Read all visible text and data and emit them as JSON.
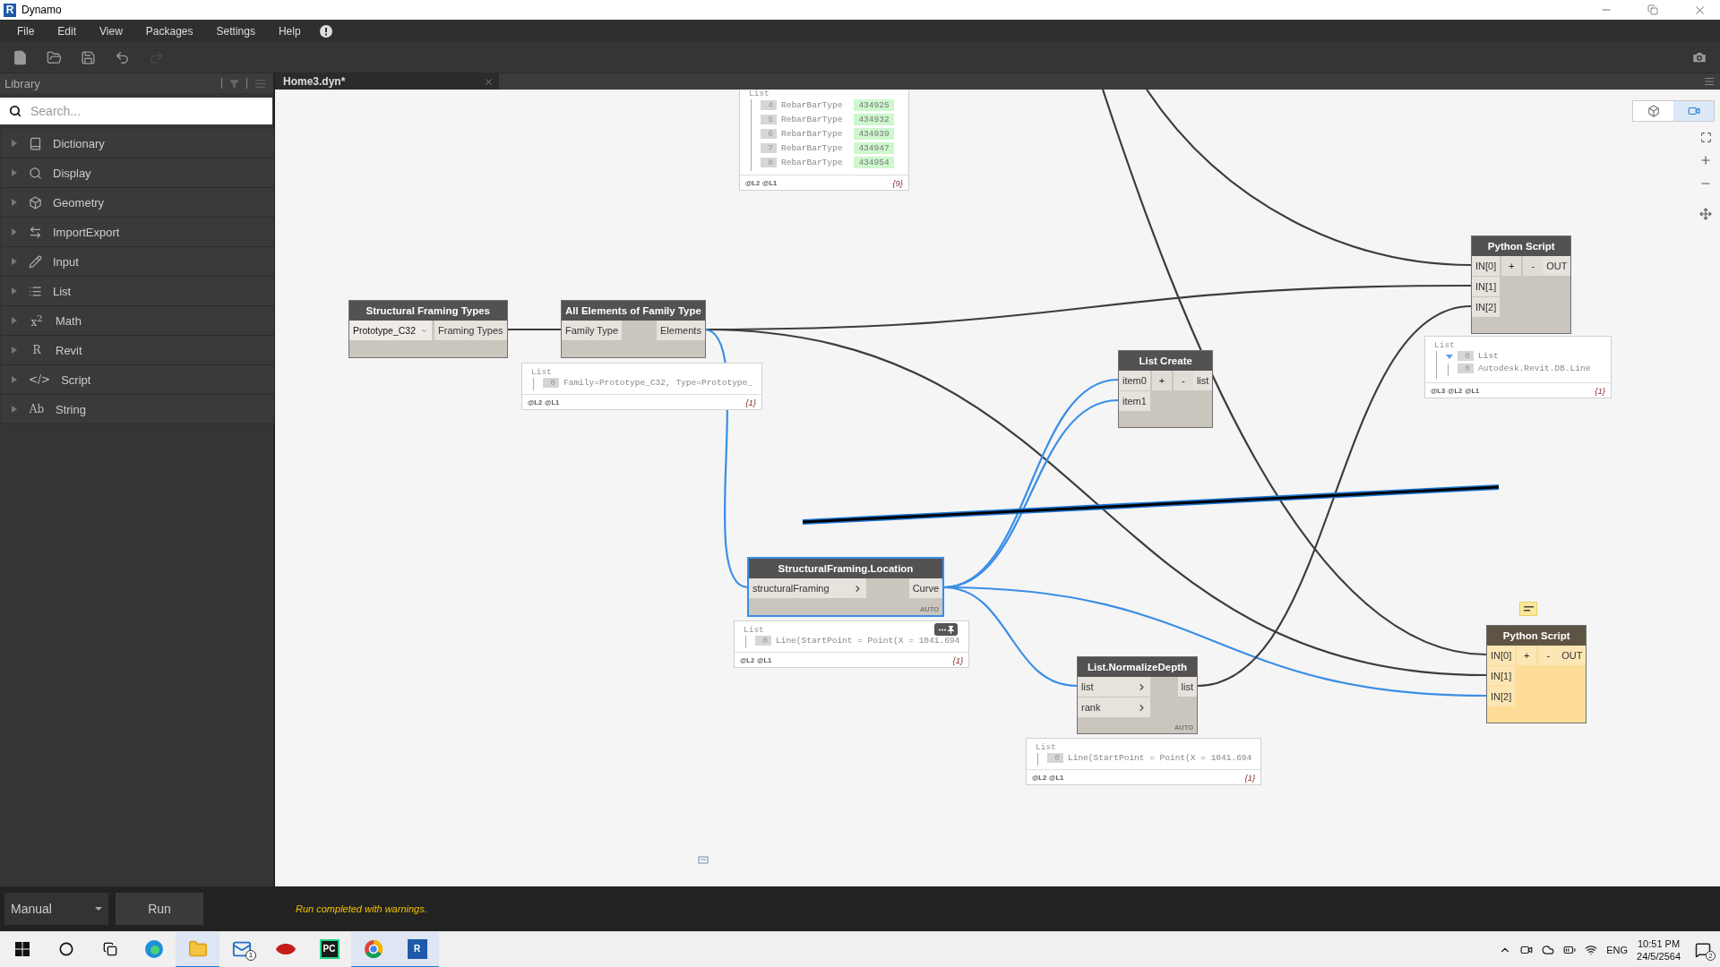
{
  "window": {
    "title": "Dynamo",
    "logo": "R"
  },
  "menu": [
    {
      "label": "File"
    },
    {
      "label": "Edit"
    },
    {
      "label": "View"
    },
    {
      "label": "Packages"
    },
    {
      "label": "Settings"
    },
    {
      "label": "Help"
    }
  ],
  "library": {
    "title": "Library",
    "search": {
      "placeholder": "Search..."
    },
    "items": [
      {
        "label": "Dictionary",
        "expanded": false
      },
      {
        "label": "Display",
        "expanded": false
      },
      {
        "label": "Geometry",
        "expanded": false
      },
      {
        "label": "ImportExport",
        "expanded": false
      },
      {
        "label": "Input",
        "expanded": false
      },
      {
        "label": "List",
        "expanded": false
      },
      {
        "label": "Math",
        "glyph": "x$^{2}$",
        "expanded": false
      },
      {
        "label": "Revit",
        "glyph": "R",
        "expanded": false
      },
      {
        "label": "Script",
        "glyph": "</>",
        "expanded": false
      },
      {
        "label": "String",
        "glyph": "Ab",
        "expanded": false
      }
    ]
  },
  "tab": {
    "title": "Home3.dyn*"
  },
  "nodes": [
    {
      "title": "Structural Framing Types",
      "kind": "dropdown",
      "selected": false,
      "warning": false,
      "dropdown": "Prototype_C32",
      "outputs": [
        "Framing Types"
      ]
    },
    {
      "title": "All Elements of Family Type",
      "kind": "function",
      "selected": false,
      "warning": false,
      "inputs": [
        {
          "label": "Family Type",
          "chevron": false
        }
      ],
      "outputs": [
        "Elements"
      ]
    },
    {
      "title": "StructuralFraming.Location",
      "kind": "function",
      "selected": true,
      "warning": false,
      "lacing": "AUTO",
      "inputs": [
        {
          "label": "structuralFraming",
          "chevron": true
        }
      ],
      "outputs": [
        "Curve"
      ]
    },
    {
      "title": "List Create",
      "kind": "variadic",
      "selected": false,
      "warning": false,
      "buttons": [
        "+",
        "-"
      ],
      "inputs": [
        {
          "label": "item0",
          "chevron": false
        },
        {
          "label": "item1",
          "chevron": false
        }
      ],
      "outputs": [
        "list"
      ]
    },
    {
      "title": "List.NormalizeDepth",
      "kind": "function",
      "selected": false,
      "warning": false,
      "lacing": "AUTO",
      "inputs": [
        {
          "label": "list",
          "chevron": true
        },
        {
          "label": "rank",
          "chevron": true
        }
      ],
      "outputs": [
        "list"
      ]
    },
    {
      "title": "Python Script",
      "kind": "variadic",
      "selected": false,
      "warning": false,
      "buttons": [
        "+",
        "-"
      ],
      "inputs": [
        {
          "label": "IN[0]",
          "chevron": false
        },
        {
          "label": "IN[1]",
          "chevron": false
        },
        {
          "label": "IN[2]",
          "chevron": false
        }
      ],
      "outputs": [
        "OUT"
      ]
    },
    {
      "title": "Python Script",
      "kind": "variadic",
      "selected": false,
      "warning": true,
      "comment": true,
      "buttons": [
        "+",
        "-"
      ],
      "inputs": [
        {
          "label": "IN[0]",
          "chevron": false
        },
        {
          "label": "IN[1]",
          "chevron": false
        },
        {
          "label": "IN[2]",
          "chevron": false
        }
      ],
      "outputs": [
        "OUT"
      ]
    }
  ],
  "previews": [
    {
      "title": "List",
      "items": [
        {
          "index": "4",
          "text": "RebarBarType",
          "value": "434925"
        },
        {
          "index": "5",
          "text": "RebarBarType",
          "value": "434932"
        },
        {
          "index": "6",
          "text": "RebarBarType",
          "value": "434939"
        },
        {
          "index": "7",
          "text": "RebarBarType",
          "value": "434947"
        },
        {
          "index": "8",
          "text": "RebarBarType",
          "value": "434954"
        }
      ],
      "levels": [
        "@L2",
        "@L1"
      ],
      "count": "{9}",
      "menu": false
    },
    {
      "title": "List",
      "items": [
        {
          "index": "0",
          "text": "Family=Prototype_C32, Type=Prototype_"
        }
      ],
      "levels": [
        "@L2",
        "@L1"
      ],
      "count": "{1}",
      "menu": false
    },
    {
      "title": "List",
      "items": [
        {
          "index": "0",
          "text": "Line(StartPoint = Point(X = 1041.694"
        }
      ],
      "levels": [
        "@L2",
        "@L1"
      ],
      "count": "{1}",
      "menu": true
    },
    {
      "title": "List",
      "items": [
        {
          "index": "0",
          "text": "Line(StartPoint = Point(X = 1041.694"
        }
      ],
      "levels": [
        "@L2",
        "@L1"
      ],
      "count": "{1}",
      "menu": false
    },
    {
      "title": "List",
      "items": [
        {
          "index": "0",
          "text": "List",
          "expanded": true,
          "children": [
            {
              "index": "0",
              "text": "Autodesk.Revit.DB.Line"
            }
          ]
        }
      ],
      "levels": [
        "@L3",
        "@L2",
        "@L1"
      ],
      "count": "{1}",
      "menu": false
    }
  ],
  "run": {
    "mode": "Manual",
    "button": "Run",
    "status": "Run completed with warnings."
  },
  "taskbar": {
    "mail_badge": "1",
    "pycharm_label": "PC",
    "revit_label": "R",
    "language": "ENG",
    "time": "10:51 PM",
    "date": "24/5/2564",
    "notification_count": "2"
  }
}
